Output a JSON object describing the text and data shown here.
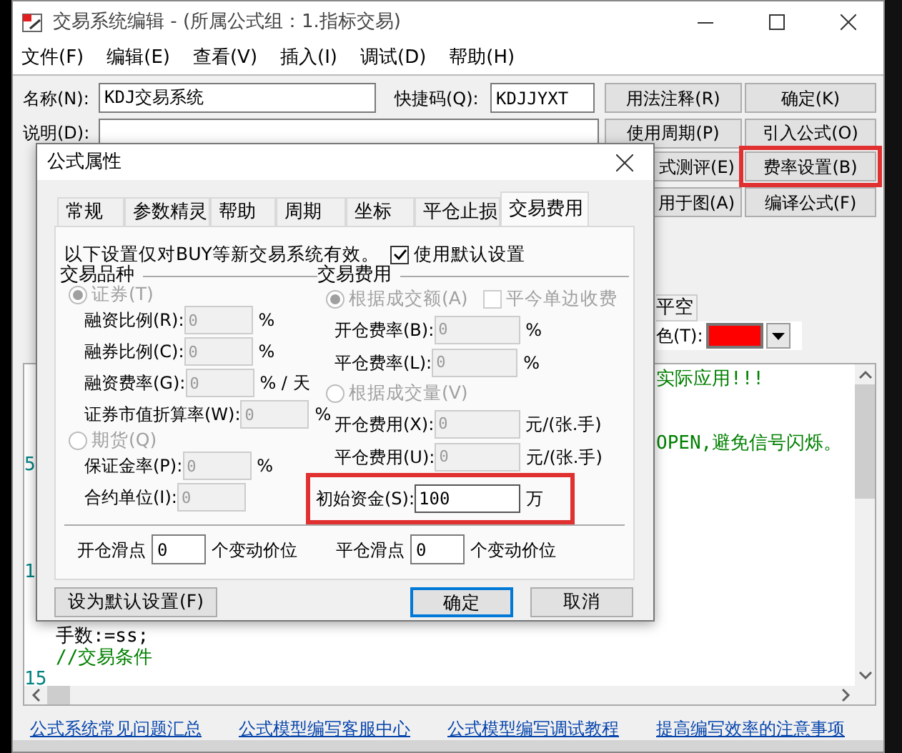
{
  "window": {
    "title": "交易系统编辑 - (所属公式组：1.指标交易)"
  },
  "menu": [
    "文件(F)",
    "编辑(E)",
    "查看(V)",
    "插入(I)",
    "调试(D)",
    "帮助(H)"
  ],
  "form": {
    "name_label": "名称(N):",
    "name_value": "KDJ交易系统",
    "shortcut_label": "快捷码(Q):",
    "shortcut_value": "KDJJYXT",
    "desc_label": "说明(D):"
  },
  "side_buttons": [
    {
      "label": "用法注释(R)",
      "highlighted": false
    },
    {
      "label": "确定(K)",
      "highlighted": false
    },
    {
      "label": "使用周期(P)",
      "highlighted": false
    },
    {
      "label": "引入公式(O)",
      "highlighted": false
    },
    {
      "label": "式测评(E)",
      "highlighted": false
    },
    {
      "label": "费率设置(B)",
      "highlighted": true
    },
    {
      "label": "用于图(A)",
      "highlighted": false
    },
    {
      "label": "编译公式(F)",
      "highlighted": false
    }
  ],
  "partial_tab": "平空",
  "color_field": {
    "label": "色(T):",
    "color": "#ff0000"
  },
  "editor": {
    "rows": [
      {
        "text": "实际应用!!!",
        "kind": "comment"
      },
      {},
      {},
      {
        "text": "OPEN,避免信号闪烁。",
        "kind": "comment"
      },
      {
        "line_number": "5"
      },
      {},
      {},
      {},
      {},
      {
        "line_number": "1"
      },
      {},
      {},
      {
        "text": "手数:=ss;",
        "kind": "code"
      },
      {
        "text": "//交易条件",
        "kind": "comment"
      },
      {
        "line_number": "15"
      }
    ]
  },
  "links": [
    "公式系统常见问题汇总",
    "公式模型编写客服中心",
    "公式模型编写调试教程",
    "提高编写效率的注意事项"
  ],
  "dialog": {
    "title": "公式属性",
    "tabs": [
      {
        "label": "常规",
        "selected": false
      },
      {
        "label": "参数精灵",
        "selected": false
      },
      {
        "label": "帮助",
        "selected": false
      },
      {
        "label": "周期",
        "selected": false
      },
      {
        "label": "坐标",
        "selected": false
      },
      {
        "label": "平仓止损",
        "selected": false
      },
      {
        "label": "交易费用",
        "selected": true
      }
    ],
    "note": "以下设置仅对BUY等新交易系统有效。",
    "use_default": {
      "label": "使用默认设置",
      "checked": true
    },
    "left_group": {
      "title": "交易品种",
      "rows": [
        {
          "kind": "radio",
          "label": "证券(T)",
          "checked": true,
          "disabled": true
        },
        {
          "kind": "field",
          "label": "融资比例(R):",
          "value": "0",
          "unit": "%",
          "disabled": true,
          "highlighted": false
        },
        {
          "kind": "field",
          "label": "融券比例(C):",
          "value": "0",
          "unit": "%",
          "disabled": true,
          "highlighted": false
        },
        {
          "kind": "field",
          "label": "融资费率(G):",
          "value": "0",
          "unit": "% / 天",
          "disabled": true,
          "highlighted": false
        },
        {
          "kind": "field",
          "label": "证券市值折算率(W):",
          "value": "0",
          "unit": "%",
          "disabled": true,
          "highlighted": false
        },
        {
          "kind": "radio",
          "label": "期货(Q)",
          "checked": false,
          "disabled": true
        },
        {
          "kind": "field",
          "label": "保证金率(P):",
          "value": "0",
          "unit": "%",
          "disabled": true,
          "highlighted": false
        },
        {
          "kind": "field",
          "label": "合约单位(I):",
          "value": "0",
          "disabled": true,
          "highlighted": false
        }
      ]
    },
    "right_group": {
      "title": "交易费用",
      "checkbox": {
        "label": "平今单边收费",
        "checked": false,
        "disabled": true
      },
      "rows": [
        {
          "kind": "radio",
          "label": "根据成交额(A)",
          "checked": true,
          "disabled": true
        },
        {
          "kind": "field",
          "label": "开仓费率(B):",
          "value": "0",
          "unit": "%",
          "disabled": true,
          "highlighted": false
        },
        {
          "kind": "field",
          "label": "平仓费率(L):",
          "value": "0",
          "unit": "%",
          "disabled": true,
          "highlighted": false
        },
        {
          "kind": "radio",
          "label": "根据成交量(V)",
          "checked": false,
          "disabled": true
        },
        {
          "kind": "field",
          "label": "开仓费用(X):",
          "value": "0",
          "unit": "元/(张.手)",
          "disabled": true,
          "highlighted": false
        },
        {
          "kind": "field",
          "label": "平仓费用(U):",
          "value": "0",
          "unit": "元/(张.手)",
          "disabled": true,
          "highlighted": false
        },
        {
          "kind": "field",
          "label": "初始资金(S):",
          "value": "100",
          "unit": "万",
          "disabled": false,
          "highlighted": true
        }
      ]
    },
    "slippage": [
      {
        "label": "开仓滑点",
        "value": "0",
        "unit": "个变动价位"
      },
      {
        "label": "平仓滑点",
        "value": "0",
        "unit": "个变动价位"
      }
    ],
    "buttons": [
      {
        "label": "设为默认设置(F)",
        "default": false
      },
      {
        "label": "确定",
        "default": true
      },
      {
        "label": "取消",
        "default": false
      }
    ]
  }
}
